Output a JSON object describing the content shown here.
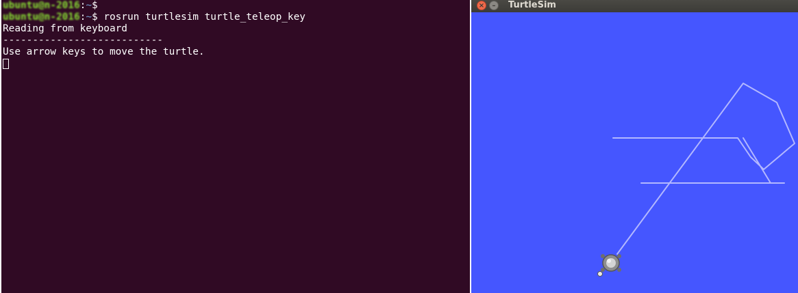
{
  "terminal": {
    "lines": [
      {
        "user": "ubuntu@n-2016",
        "path": "~",
        "sign": "$",
        "command": ""
      },
      {
        "user": "ubuntu@n-2016",
        "path": "~",
        "sign": "$",
        "command": " rosrun turtlesim turtle_teleop_key"
      }
    ],
    "output": [
      "Reading from keyboard",
      "---------------------------",
      "Use arrow keys to move the turtle."
    ]
  },
  "sim": {
    "title": "TurtleSim",
    "close_glyph": "×",
    "minimize_glyph": "–",
    "background": "#4556ff",
    "trail_color": "#b3b8ff"
  }
}
